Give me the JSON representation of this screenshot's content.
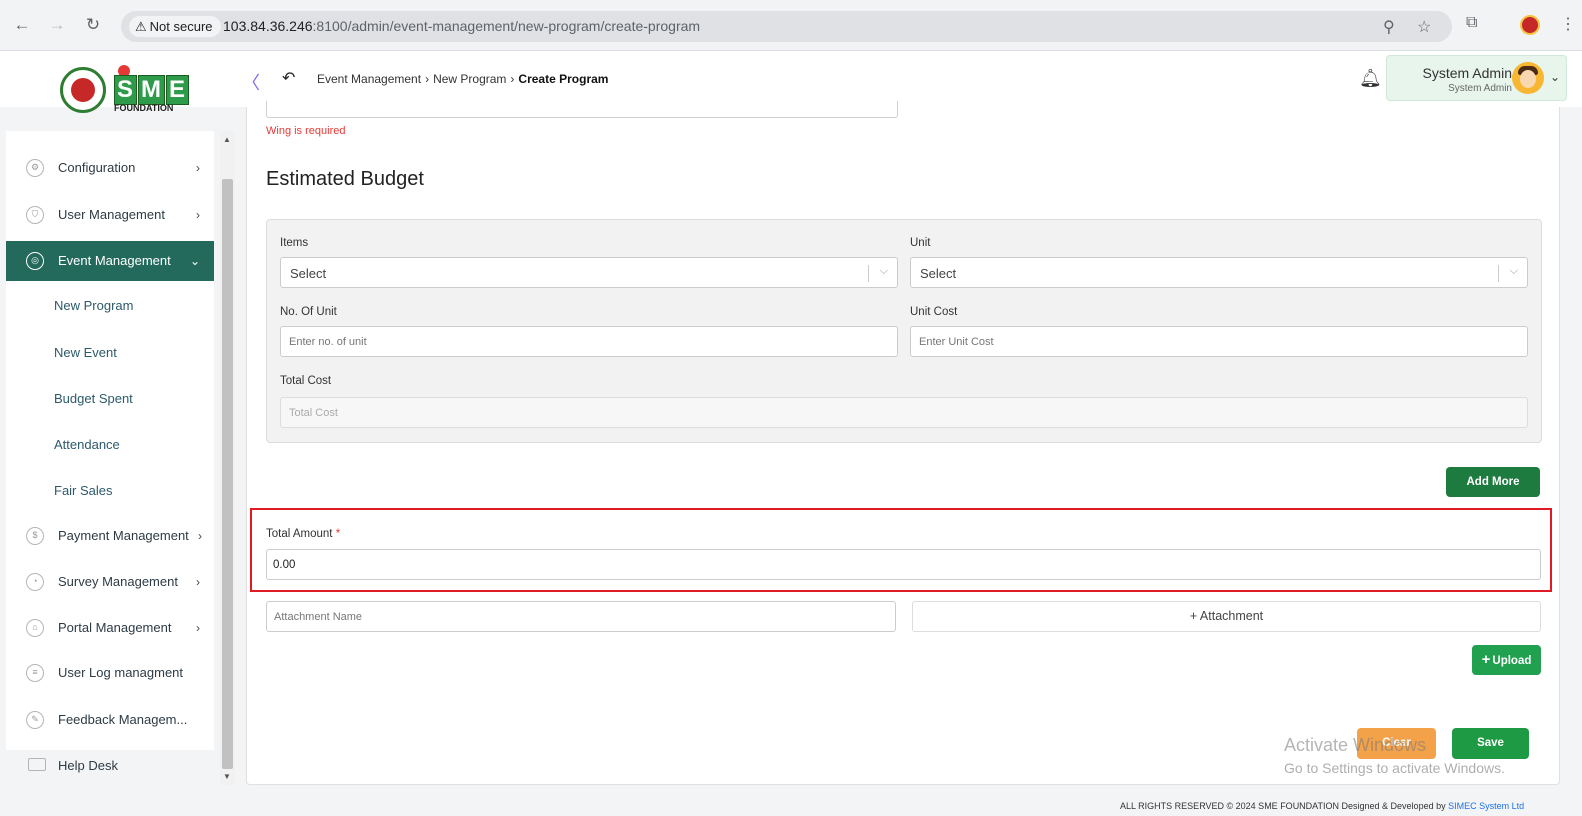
{
  "browser": {
    "security_label": "Not secure",
    "url_host": "103.84.36.246",
    "url_rest": ":8100/admin/event-management/new-program/create-program"
  },
  "header": {
    "breadcrumb": [
      "Event Management",
      "New Program",
      "Create Program"
    ],
    "user": {
      "name": "System Admin",
      "role": "System Admin"
    },
    "logo_text": {
      "letters": [
        "S",
        "M",
        "E"
      ],
      "foundation": "FOUNDATION"
    }
  },
  "sidebar": {
    "items": [
      {
        "label": "Configuration",
        "icon": "config-icon"
      },
      {
        "label": "User Management",
        "icon": "user-shield-icon"
      },
      {
        "label": "Event Management",
        "icon": "event-icon",
        "active": true
      },
      {
        "label": "Payment Management",
        "icon": "payment-icon"
      },
      {
        "label": "Survey Management",
        "icon": "pie-chart-icon"
      },
      {
        "label": "Portal Management",
        "icon": "portal-icon"
      },
      {
        "label": "User Log managment",
        "icon": "log-icon"
      },
      {
        "label": "Feedback Managem...",
        "icon": "feedback-icon"
      }
    ],
    "sub_items": [
      "New Program",
      "New Event",
      "Budget Spent",
      "Attendance",
      "Fair Sales"
    ],
    "help_desk": "Help Desk"
  },
  "form": {
    "wing_error": "Wing is required",
    "section_title": "Estimated Budget",
    "items_label": "Items",
    "items_value": "Select",
    "unit_label": "Unit",
    "unit_value": "Select",
    "no_of_unit_label": "No. Of Unit",
    "no_of_unit_placeholder": "Enter no. of unit",
    "unit_cost_label": "Unit Cost",
    "unit_cost_placeholder": "Enter Unit Cost",
    "total_cost_label": "Total Cost",
    "total_cost_placeholder": "Total Cost",
    "add_more_label": "Add More",
    "total_amount_label": "Total Amount",
    "total_amount_required": "*",
    "total_amount_value": "0.00",
    "attachment_name_placeholder": "Attachment Name",
    "attachment_button_label": "+ Attachment",
    "upload_label": "Upload",
    "clear_label": "Clear",
    "save_label": "Save"
  },
  "watermark": {
    "line1": "Activate Windows",
    "line2": "Go to Settings to activate Windows."
  },
  "footer": {
    "text": "ALL RIGHTS RESERVED © 2024 SME FOUNDATION   Designed & Developed by",
    "link": "SIMEC System Ltd"
  },
  "colors": {
    "active_nav": "#236a5c",
    "primary_button": "#1e7b3f",
    "clear_button": "#f4a24a",
    "error": "#e53935",
    "highlight_border": "#e01b24"
  }
}
